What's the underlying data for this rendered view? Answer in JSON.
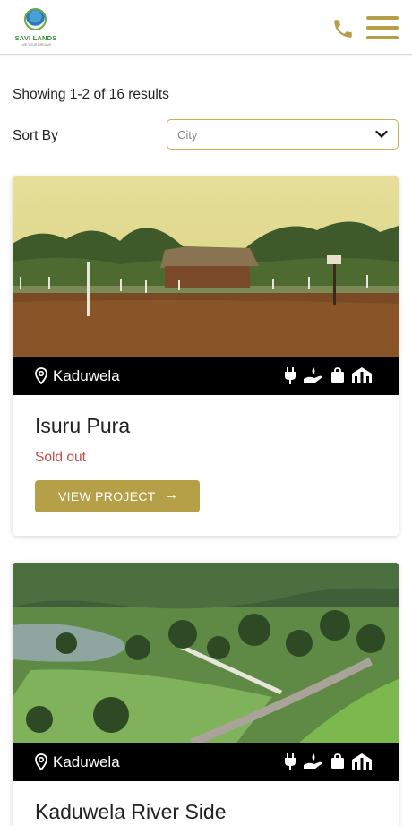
{
  "header": {
    "brand": "SAVI LANDS",
    "brand_sub": "LIVE YOUR DREAMS",
    "icons": [
      "phone-icon",
      "hamburger-menu-icon"
    ]
  },
  "listing": {
    "results_text": "Showing 1-2 of 16 results",
    "sort_label": "Sort By",
    "sort_value": "City"
  },
  "projects": [
    {
      "location": "Kaduwela",
      "title": "Isuru Pura",
      "status": "Sold out",
      "button": "VIEW PROJECT",
      "button_icon": "→",
      "amenities": [
        "electricity-icon",
        "water-icon",
        "shopping-icon",
        "school-icon"
      ]
    },
    {
      "location": "Kaduwela",
      "title": "Kaduwela River Side",
      "amenities": [
        "electricity-icon",
        "water-icon",
        "shopping-icon",
        "school-icon"
      ]
    }
  ],
  "colors": {
    "accent": "#b5a048",
    "status_sold": "#c0504d",
    "location_bar": "#000000"
  }
}
